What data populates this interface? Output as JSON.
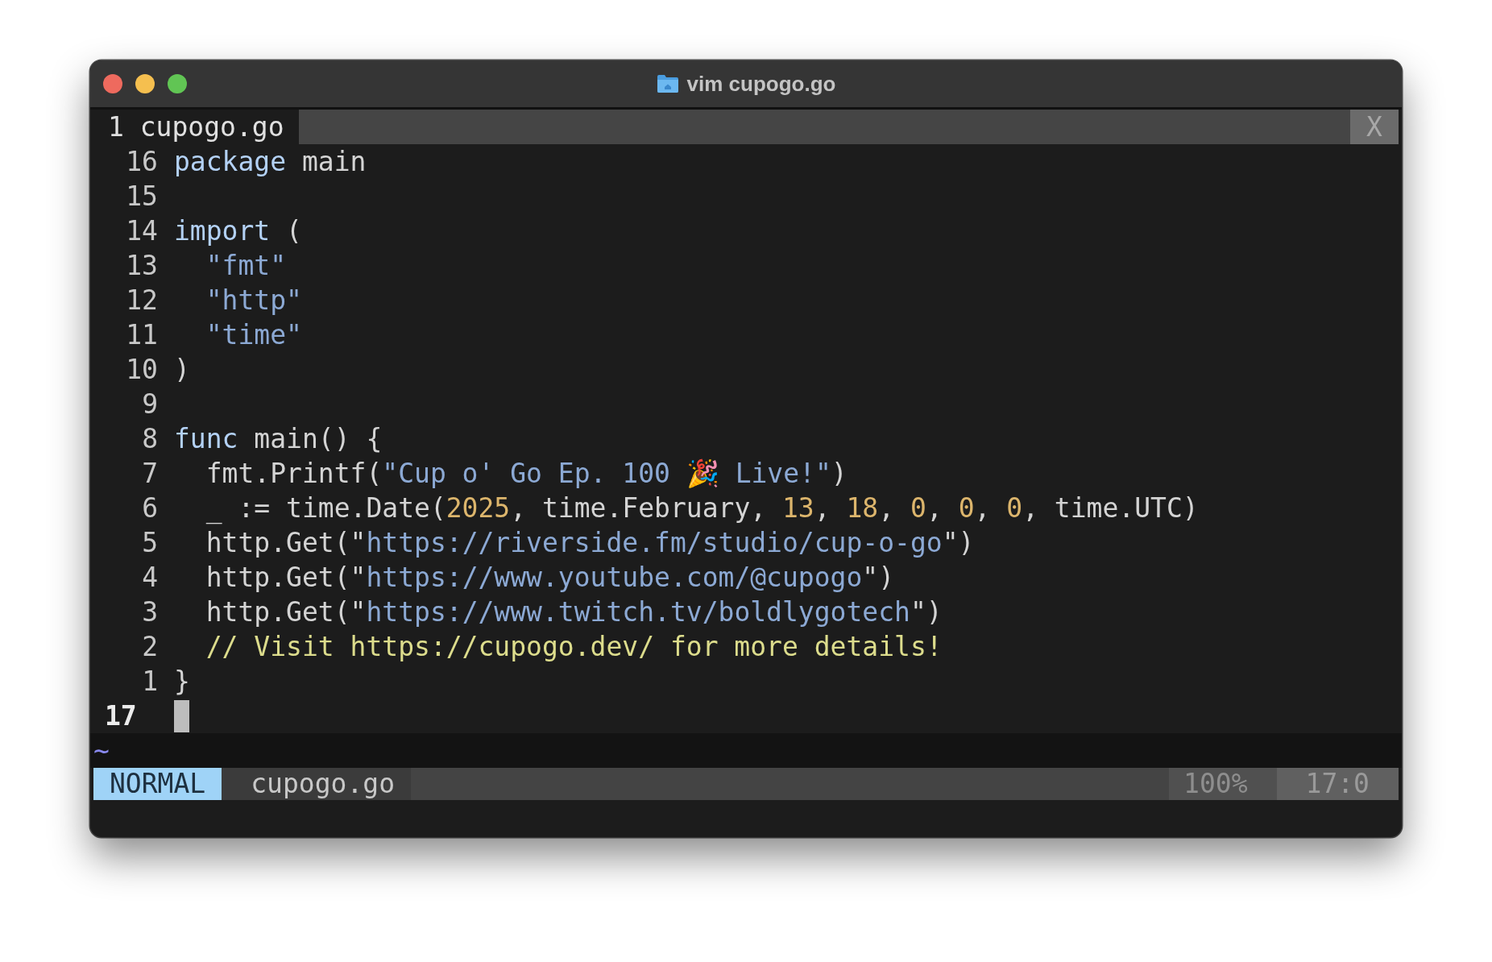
{
  "window": {
    "title": "vim cupogo.go"
  },
  "tabline": {
    "tabs": [
      {
        "number": "1",
        "label": "cupogo.go",
        "selected": true
      }
    ],
    "close": "X"
  },
  "lines": [
    {
      "number": "16",
      "current": false,
      "indented": false,
      "tokens": [
        {
          "kind": "keyword",
          "text": "package"
        },
        {
          "kind": "plain",
          "text": " main"
        }
      ]
    },
    {
      "number": "15",
      "current": false
    },
    {
      "number": "14",
      "current": false,
      "indented": false,
      "tokens": [
        {
          "kind": "keyword",
          "text": "import"
        },
        {
          "kind": "plain",
          "text": " ("
        }
      ]
    },
    {
      "number": "13",
      "current": false,
      "indented": true,
      "tokens": [
        {
          "kind": "string",
          "text": "\"fmt\""
        }
      ]
    },
    {
      "number": "12",
      "current": false,
      "indented": true,
      "tokens": [
        {
          "kind": "string",
          "text": "\"http\""
        }
      ]
    },
    {
      "number": "11",
      "current": false,
      "indented": true,
      "tokens": [
        {
          "kind": "string",
          "text": "\"time\""
        }
      ]
    },
    {
      "number": "10",
      "current": false,
      "indented": false,
      "tokens": [
        {
          "kind": "plain",
          "text": ")"
        }
      ]
    },
    {
      "number": "9",
      "current": false
    },
    {
      "number": "8",
      "current": false,
      "indented": false,
      "tokens": [
        {
          "kind": "keyword",
          "text": "func"
        },
        {
          "kind": "plain",
          "text": " main() {"
        }
      ]
    },
    {
      "number": "7",
      "current": false,
      "indented": true,
      "tokens": [
        {
          "kind": "plain",
          "text": "fmt.Printf("
        },
        {
          "kind": "string",
          "text": "\"Cup o' Go Ep. 100 🎉 Live!\""
        },
        {
          "kind": "plain",
          "text": ")"
        }
      ]
    },
    {
      "number": "6",
      "current": false,
      "indented": true,
      "tokens": [
        {
          "kind": "plain",
          "text": "_ := time.Date("
        },
        {
          "kind": "number",
          "text": "2025"
        },
        {
          "kind": "plain",
          "text": ", time.February, "
        },
        {
          "kind": "number",
          "text": "13"
        },
        {
          "kind": "plain",
          "text": ", "
        },
        {
          "kind": "number",
          "text": "18"
        },
        {
          "kind": "plain",
          "text": ", "
        },
        {
          "kind": "number",
          "text": "0"
        },
        {
          "kind": "plain",
          "text": ", "
        },
        {
          "kind": "number",
          "text": "0"
        },
        {
          "kind": "plain",
          "text": ", "
        },
        {
          "kind": "number",
          "text": "0"
        },
        {
          "kind": "plain",
          "text": ", time.UTC)"
        }
      ]
    },
    {
      "number": "5",
      "current": false,
      "indented": true,
      "tokens": [
        {
          "kind": "plain",
          "text": "http.Get(\""
        },
        {
          "kind": "string",
          "text": "https://riverside.fm/studio/cup-o-go"
        },
        {
          "kind": "plain",
          "text": "\")"
        }
      ]
    },
    {
      "number": "4",
      "current": false,
      "indented": true,
      "tokens": [
        {
          "kind": "plain",
          "text": "http.Get(\""
        },
        {
          "kind": "string",
          "text": "https://www.youtube.com/@cupogo"
        },
        {
          "kind": "plain",
          "text": "\")"
        }
      ]
    },
    {
      "number": "3",
      "current": false,
      "indented": true,
      "tokens": [
        {
          "kind": "plain",
          "text": "http.Get(\""
        },
        {
          "kind": "string",
          "text": "https://www.twitch.tv/boldlygotech"
        },
        {
          "kind": "plain",
          "text": "\")"
        }
      ]
    },
    {
      "number": "2",
      "current": false,
      "indented": true,
      "tokens": [
        {
          "kind": "comment",
          "text": "// Visit https://cupogo.dev/ for more details!"
        }
      ]
    },
    {
      "number": "1",
      "current": false,
      "indented": false,
      "tokens": [
        {
          "kind": "plain",
          "text": "}"
        }
      ]
    },
    {
      "number": "17",
      "current": true
    }
  ],
  "tilde": "~",
  "statusline": {
    "mode": "NORMAL",
    "file": "cupogo.go",
    "percent": "100%",
    "position": "17:0"
  }
}
